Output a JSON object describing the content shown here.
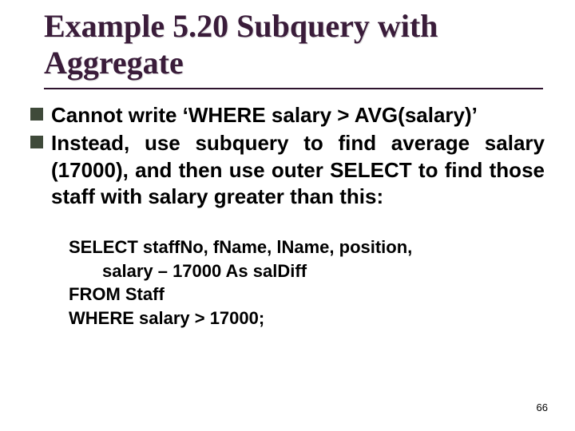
{
  "title": "Example 5.20  Subquery with Aggregate",
  "bullets": [
    "Cannot write ‘WHERE salary > AVG(salary)’",
    "Instead, use subquery to find average salary (17000), and then use outer SELECT to find those staff with salary greater than this:"
  ],
  "code_lines": [
    {
      "text": "SELECT staffNo, fName, lName, position,",
      "indent": false
    },
    {
      "text": "salary – 17000 As salDiff",
      "indent": true
    },
    {
      "text": "FROM Staff",
      "indent": false
    },
    {
      "text": "WHERE salary > 17000;",
      "indent": false
    }
  ],
  "page_number": "66"
}
